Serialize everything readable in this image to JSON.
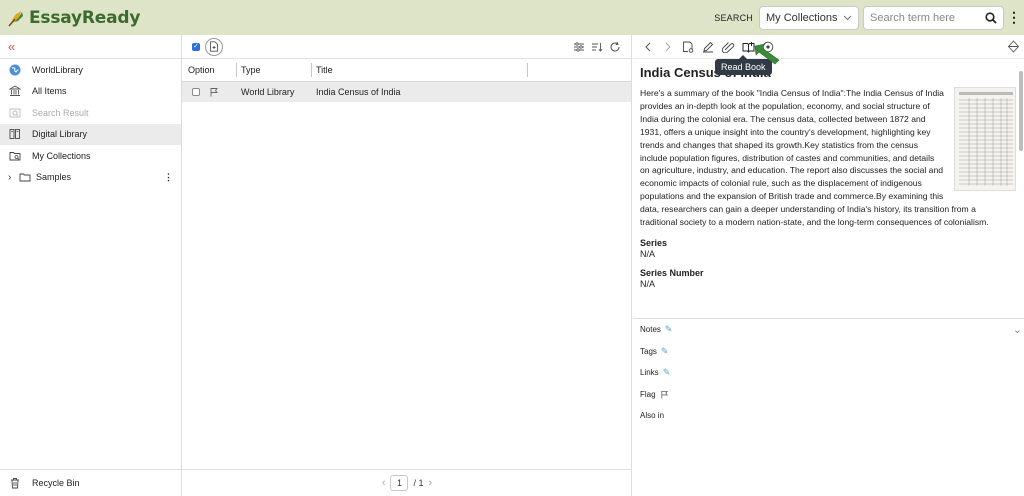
{
  "header": {
    "app_name": "EssayReady",
    "search_label": "SEARCH",
    "collection_select": "My Collections",
    "search_placeholder": "Search term here"
  },
  "sidebar": {
    "items": [
      {
        "label": "WorldLibrary",
        "icon": "globe-icon"
      },
      {
        "label": "All Items",
        "icon": "library-icon"
      },
      {
        "label": "Search Result",
        "icon": "search-result-icon"
      },
      {
        "label": "Digital Library",
        "icon": "books-icon"
      },
      {
        "label": "My Collections",
        "icon": "collections-icon"
      },
      {
        "label": "Samples",
        "icon": "folder-icon"
      }
    ],
    "recycle_bin": "Recycle Bin"
  },
  "list": {
    "columns": [
      "Option",
      "Type",
      "Title"
    ],
    "rows": [
      {
        "type": "World Library",
        "title": "India Census of India"
      }
    ],
    "pager": {
      "current": "1",
      "total": "/ 1"
    }
  },
  "detail": {
    "tooltip": "Read Book",
    "title": "India Census of India",
    "summary": "Here's a summary of the book \"India Census of India\":The India Census of India provides an in-depth look at the population, economy, and social structure of India during the colonial era. The census data, collected between 1872 and 1931, offers a unique insight into the country's development, highlighting key trends and changes that shaped its growth.Key statistics from the census include population figures, distribution of castes and communities, and details on agriculture, industry, and education. The report also discusses the social and economic impacts of colonial rule, such as the displacement of indigenous populations and the expansion of British trade and commerce.By examining this data, researchers can gain a deeper understanding of India's history, its transition from a traditional society to a modern nation-state, and the long-term consequences of colonialism.",
    "fields": [
      {
        "label": "Series",
        "value": "N/A"
      },
      {
        "label": "Series Number",
        "value": "N/A"
      }
    ],
    "meta": [
      "Notes",
      "Tags",
      "Links",
      "Flag",
      "Also in"
    ]
  },
  "colors": {
    "header_bg": "#dde4c8",
    "brand_green": "#3d6b2e",
    "selected_row": "#ebebeb",
    "accent_red": "#d9534f",
    "checkbox_blue": "#2a6fdb"
  }
}
